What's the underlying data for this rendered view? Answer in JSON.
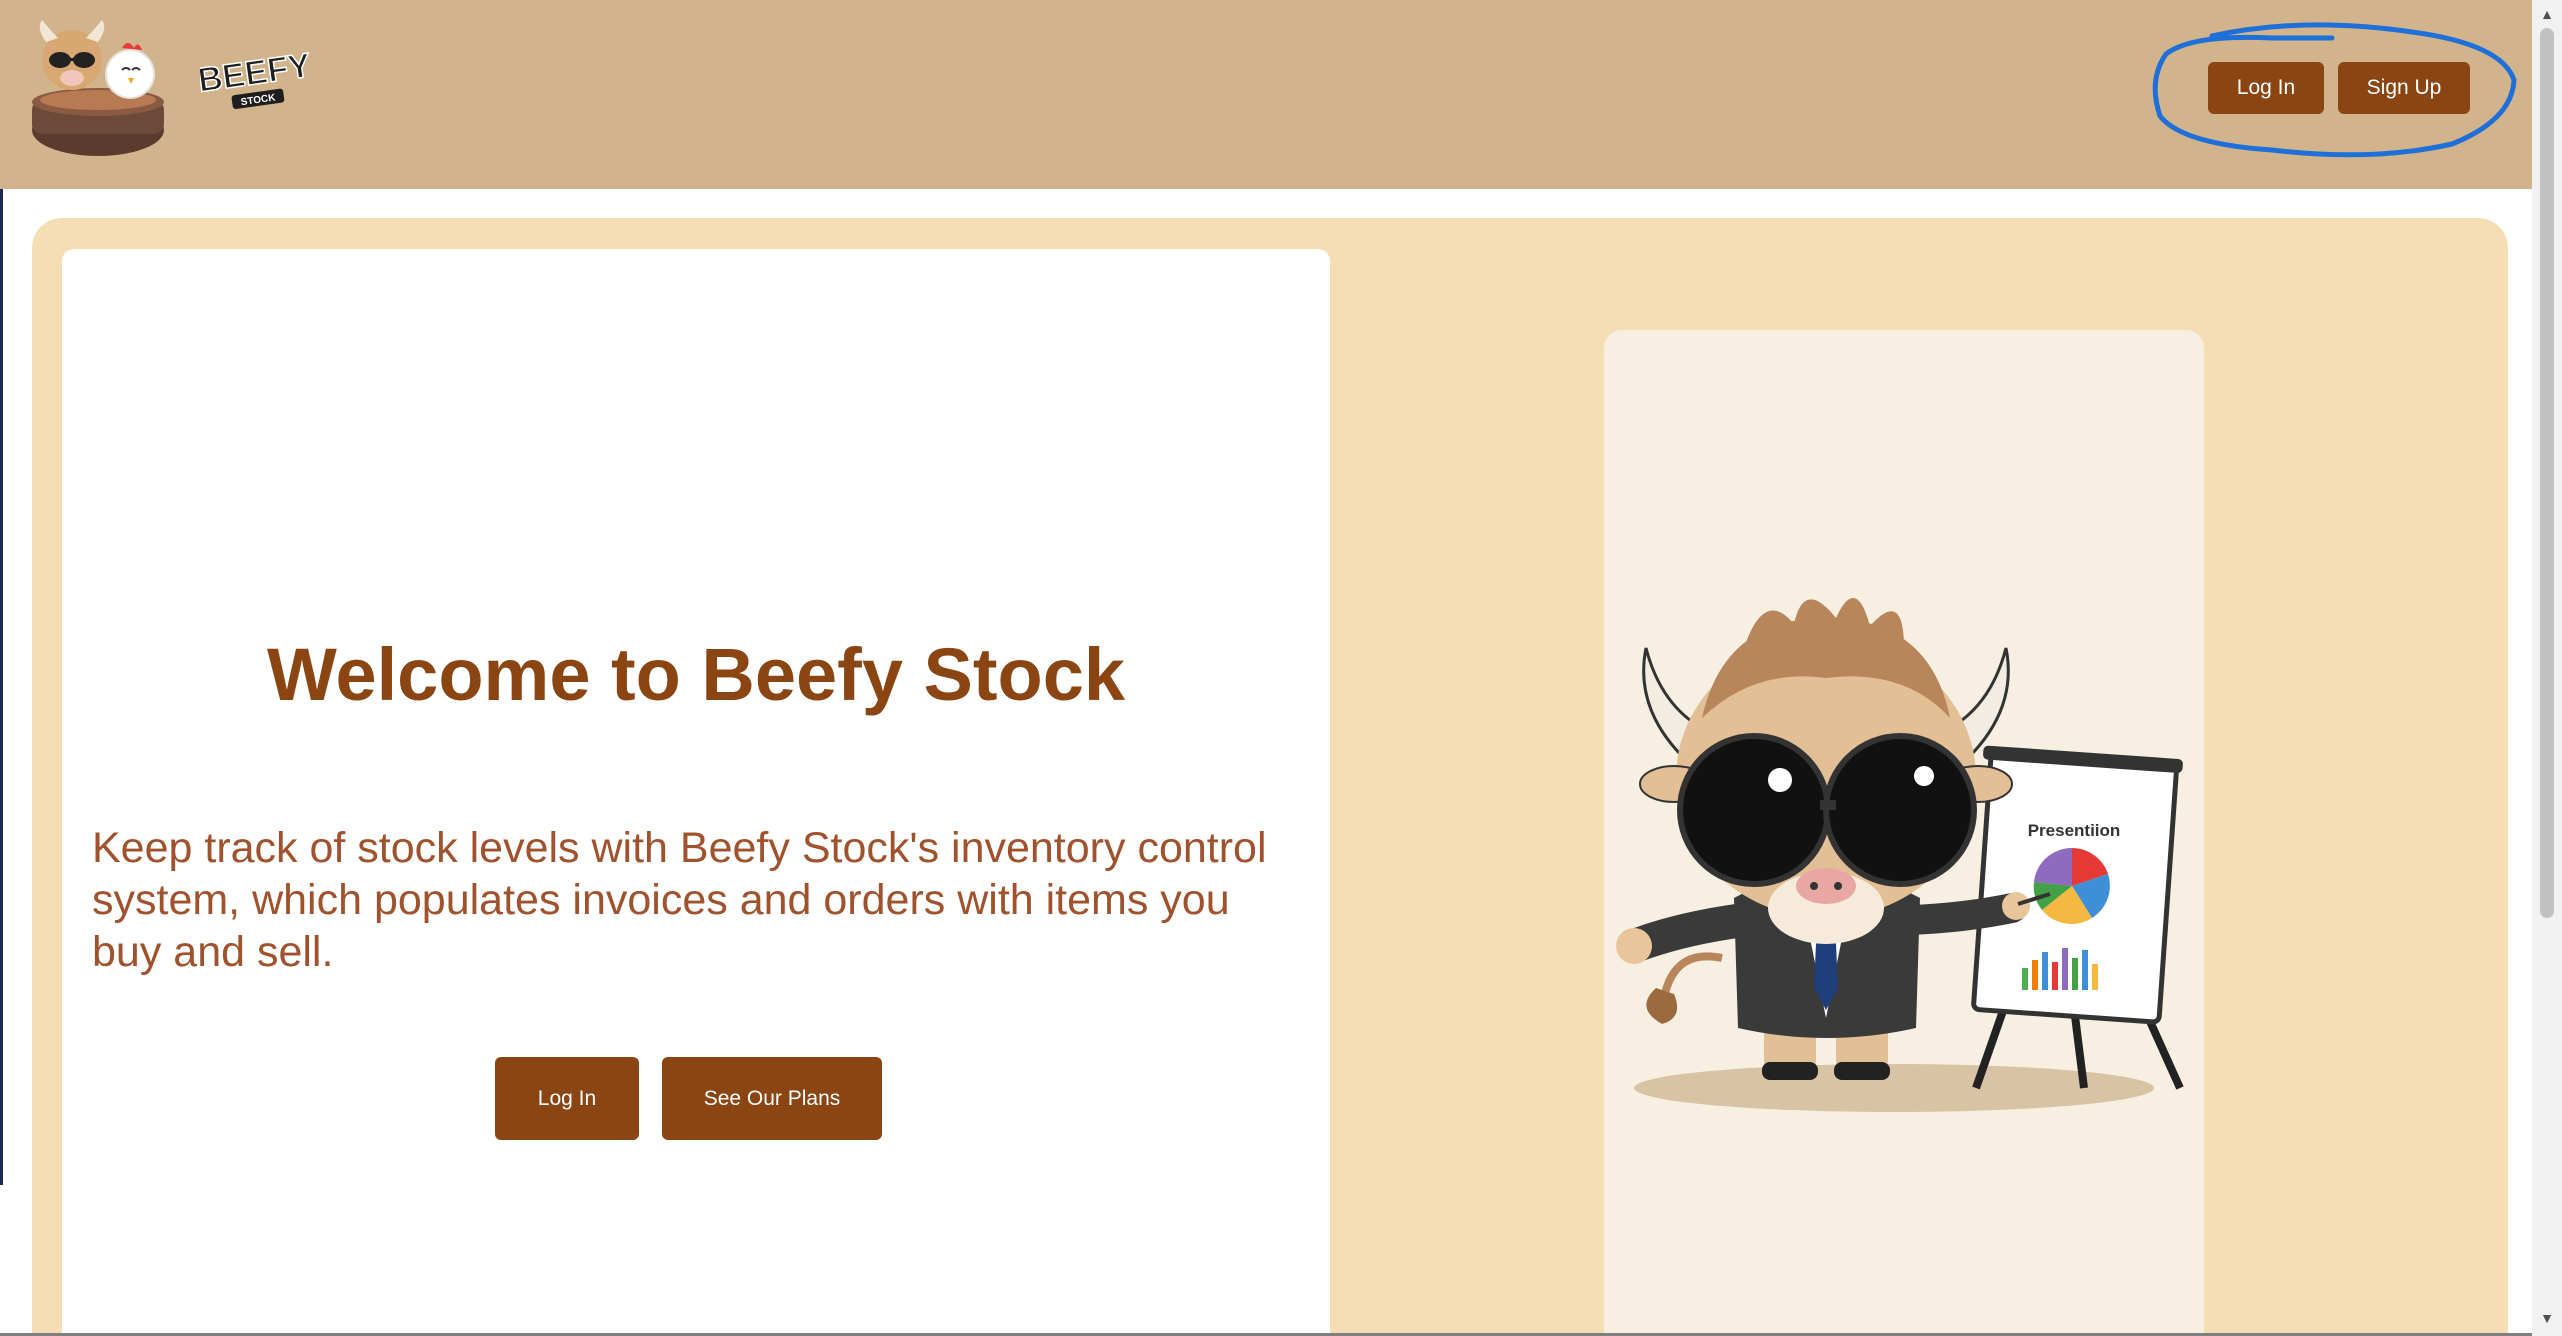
{
  "header": {
    "logo_text": "BEEFY",
    "logo_subtext": "STOCK",
    "login_label": "Log In",
    "signup_label": "Sign Up"
  },
  "hero": {
    "title": "Welcome to Beefy Stock",
    "description": "Keep track of stock levels with Beefy Stock's inventory control system, which populates invoices and orders with items you buy and sell.",
    "login_label": "Log In",
    "plans_label": "See Our Plans"
  },
  "illustration": {
    "board_label": "Presentiion"
  },
  "colors": {
    "header_bg": "#d2b48c",
    "main_bg": "#f5deb3",
    "accent": "#8b4513",
    "text_secondary": "#a0522d",
    "annotation": "#1e6fd9"
  },
  "icons": {
    "logo": "cow-chicken-pot-logo",
    "mascot": "cow-presenter-illustration",
    "scroll_up": "chevron-up-icon",
    "scroll_down": "chevron-down-icon"
  }
}
